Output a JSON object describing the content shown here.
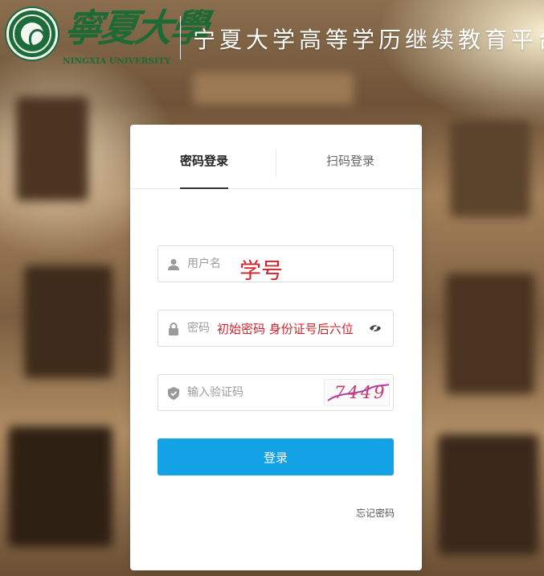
{
  "header": {
    "logo_script": "寧夏大學",
    "logo_en": "NINGXIA UNIVERSITY",
    "platform_title": "宁夏大学高等学历继续教育平台"
  },
  "tabs": [
    {
      "label": "密码登录",
      "active": true
    },
    {
      "label": "扫码登录",
      "active": false
    }
  ],
  "form": {
    "username": {
      "placeholder": "用户名",
      "value": "",
      "hint": "学号"
    },
    "password": {
      "placeholder": "密码",
      "value": "",
      "hint": "初始密码 身份证号后六位"
    },
    "captcha": {
      "placeholder": "输入验证码",
      "value": "",
      "image_text": "7449"
    },
    "login_label": "登录",
    "forgot_label": "忘记密码"
  },
  "colors": {
    "accent": "#13a2e6",
    "hint_red": "#d0232b",
    "logo_green": "#1e6a35"
  },
  "icons": {
    "username": "user-icon",
    "password": "lock-icon",
    "captcha": "shield-icon",
    "toggle": "eye-icon"
  }
}
